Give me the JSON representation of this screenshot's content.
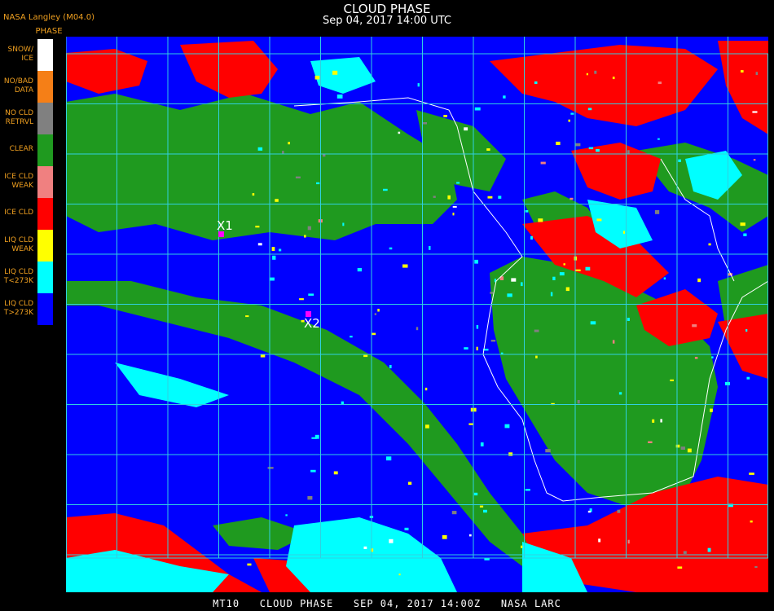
{
  "header": {
    "title": "CLOUD PHASE",
    "subtitle": "Sep 04, 2017 14:00 UTC",
    "credit": "NASA Langley (M04.0)",
    "legend_title": "PHASE"
  },
  "legend": [
    {
      "lines": [
        "SNOW/",
        "ICE"
      ],
      "color": "#ffffff"
    },
    {
      "lines": [
        "NO/BAD",
        "DATA"
      ],
      "color": "#f57f17"
    },
    {
      "lines": [
        "NO CLD",
        "RETRVL"
      ],
      "color": "#808080"
    },
    {
      "lines": [
        "CLEAR"
      ],
      "color": "#1f9a1f"
    },
    {
      "lines": [
        "ICE CLD",
        "WEAK"
      ],
      "color": "#f08080"
    },
    {
      "lines": [
        "ICE CLD"
      ],
      "color": "#ff0000"
    },
    {
      "lines": [
        "LIQ CLD",
        "WEAK"
      ],
      "color": "#ffff00"
    },
    {
      "lines": [
        "LIQ CLD",
        "T<273K"
      ],
      "color": "#00ffff"
    },
    {
      "lines": [
        "LIQ CLD",
        "T>273K"
      ],
      "color": "#0000ff"
    }
  ],
  "markers": [
    {
      "label": "X1",
      "color": "#ff00ff"
    },
    {
      "label": "X2",
      "color": "#ff00ff"
    }
  ],
  "grid_color": "#30d0e0",
  "coast_color": "#ffffff",
  "footer": "MT10   CLOUD PHASE   SEP 04, 2017 14:00Z   NASA LARC"
}
